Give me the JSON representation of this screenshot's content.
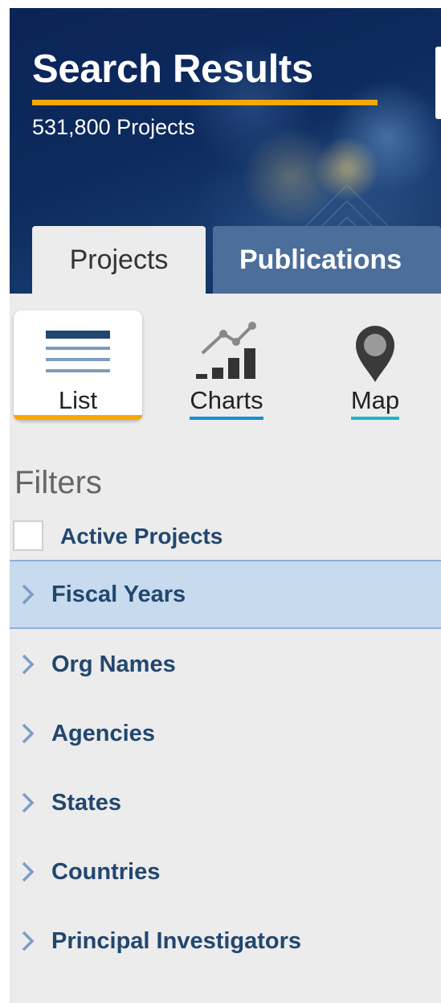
{
  "header": {
    "title": "Search Results",
    "count": "531,800 Projects"
  },
  "tabs": [
    {
      "label": "Projects",
      "active": true
    },
    {
      "label": "Publications",
      "active": false
    }
  ],
  "views": [
    {
      "label": "List",
      "icon": "list-icon",
      "active": true
    },
    {
      "label": "Charts",
      "icon": "charts-icon",
      "active": false
    },
    {
      "label": "Map",
      "icon": "map-pin-icon",
      "active": false
    }
  ],
  "filters": {
    "heading": "Filters",
    "active_projects_label": "Active Projects",
    "active_projects_checked": false,
    "items": [
      {
        "label": "Fiscal Years",
        "selected": true
      },
      {
        "label": "Org Names",
        "selected": false
      },
      {
        "label": "Agencies",
        "selected": false
      },
      {
        "label": "States",
        "selected": false
      },
      {
        "label": "Countries",
        "selected": false
      },
      {
        "label": "Principal Investigators",
        "selected": false
      }
    ]
  },
  "colors": {
    "hero_bg": "#0d2b5e",
    "accent_orange": "#f7a800",
    "tab_inactive": "#4b6e9a",
    "filter_text": "#22476f",
    "filter_selected_bg": "#c7daee",
    "charts_underline": "#1a8fd1",
    "map_underline": "#1ab8c8"
  }
}
